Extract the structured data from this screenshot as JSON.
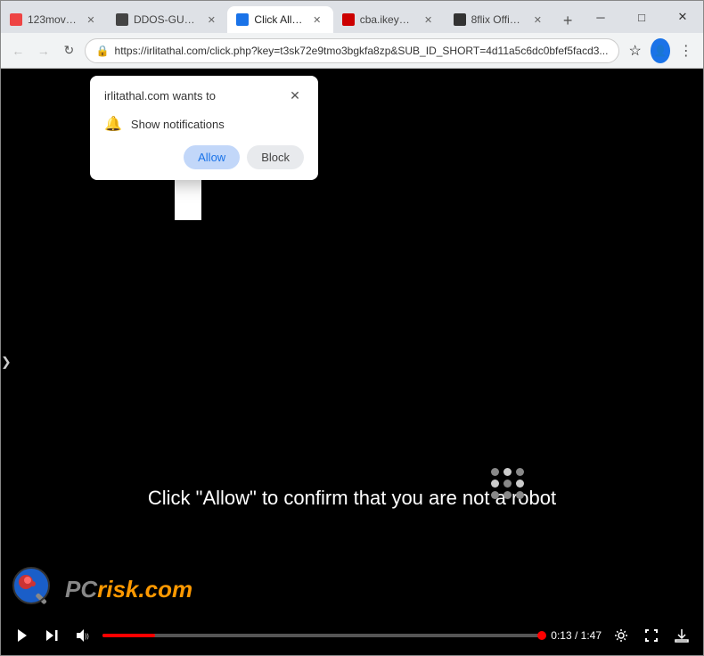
{
  "tabs": [
    {
      "id": "123movies",
      "label": "123movies",
      "favicon_color": "#e44",
      "active": false
    },
    {
      "id": "ddos",
      "label": "DDOS-GUA...",
      "favicon_color": "#444",
      "active": false
    },
    {
      "id": "clickallow",
      "label": "Click Allow",
      "favicon_color": "#1a73e8",
      "active": true
    },
    {
      "id": "cba",
      "label": "cba.ikeym...",
      "favicon_color": "#c00",
      "active": false
    },
    {
      "id": "bflix",
      "label": "8flix Offici...",
      "favicon_color": "#222",
      "active": false
    }
  ],
  "address_bar": {
    "url": "https://irlitathal.com/click.php?key=t3sk72e9tmo3bgkfa8zp&SUB_ID_SHORT=4d11a5c6dc0bfef5facd3...",
    "security_icon": "🔒"
  },
  "notification_popup": {
    "title": "irlitathal.com wants to",
    "notification_label": "Show notifications",
    "allow_label": "Allow",
    "block_label": "Block"
  },
  "page": {
    "instruction_text": "Click \"Allow\" to confirm that you are not a robot"
  },
  "video_controls": {
    "current_time": "0:13",
    "total_time": "1:47"
  },
  "window_controls": {
    "minimize": "─",
    "maximize": "□",
    "close": "✕"
  },
  "pcrisk": {
    "text_gray": "PC",
    "text_orange": "risk.com"
  }
}
